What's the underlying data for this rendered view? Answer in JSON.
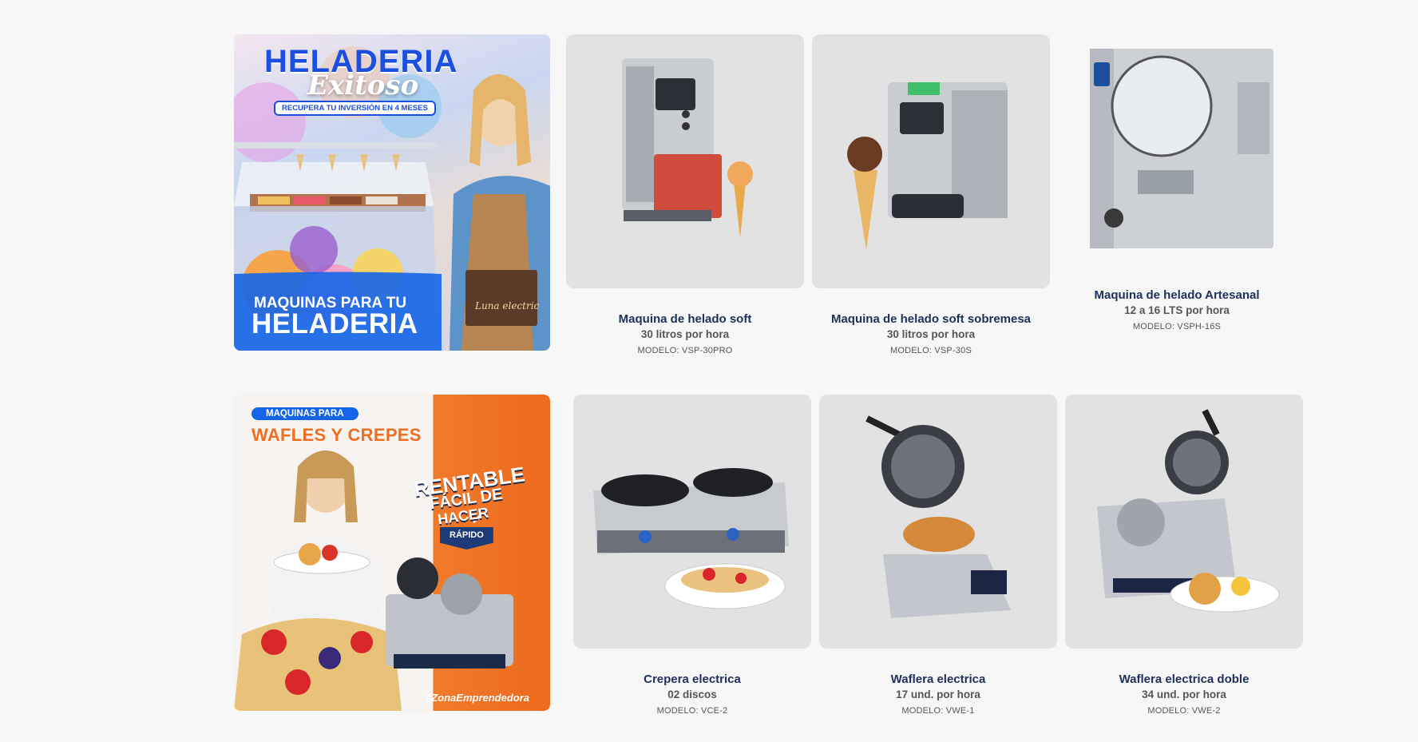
{
  "banner_heladeria": {
    "title": "HELADERIA",
    "script_title": "Exitoso",
    "tagline": "RECUPERA TU INVERSIÓN EN 4 MESES",
    "footer_line1": "MAQUINAS PARA TU",
    "footer_line2": "HELADERIA",
    "bag_label": "Luna electric"
  },
  "banner_wafles": {
    "pill": "MAQUINAS PARA",
    "title": "WAFLES Y CREPES",
    "badge_line1": "RENTABLE",
    "badge_line2": "FÁCIL DE",
    "badge_line3": "HACER",
    "badge_tag": "RÁPIDO",
    "hashtag": "#ZonaEmprendedora"
  },
  "products_row1": [
    {
      "name": "Maquina de helado soft",
      "spec": "30 litros por hora",
      "model": "MODELO: VSP-30PRO"
    },
    {
      "name": "Maquina de helado soft sobremesa",
      "spec": "30 litros por hora",
      "model": "MODELO: VSP-30S"
    },
    {
      "name": "Maquina de helado Artesanal",
      "spec": "12 a 16 LTS por hora",
      "model": "MODELO: VSPH-16S"
    }
  ],
  "products_row2": [
    {
      "name": "Crepera electrica",
      "spec": "02 discos",
      "model": "MODELO: VCE-2"
    },
    {
      "name": "Waflera electrica",
      "spec": "17 und. por hora",
      "model": "MODELO: VWE-1"
    },
    {
      "name": "Waflera electrica doble",
      "spec": "34 und. por hora",
      "model": "MODELO: VWE-2"
    }
  ],
  "colors": {
    "navy": "#1e2f5a",
    "orange": "#ef6f22",
    "blue": "#1565e8"
  }
}
